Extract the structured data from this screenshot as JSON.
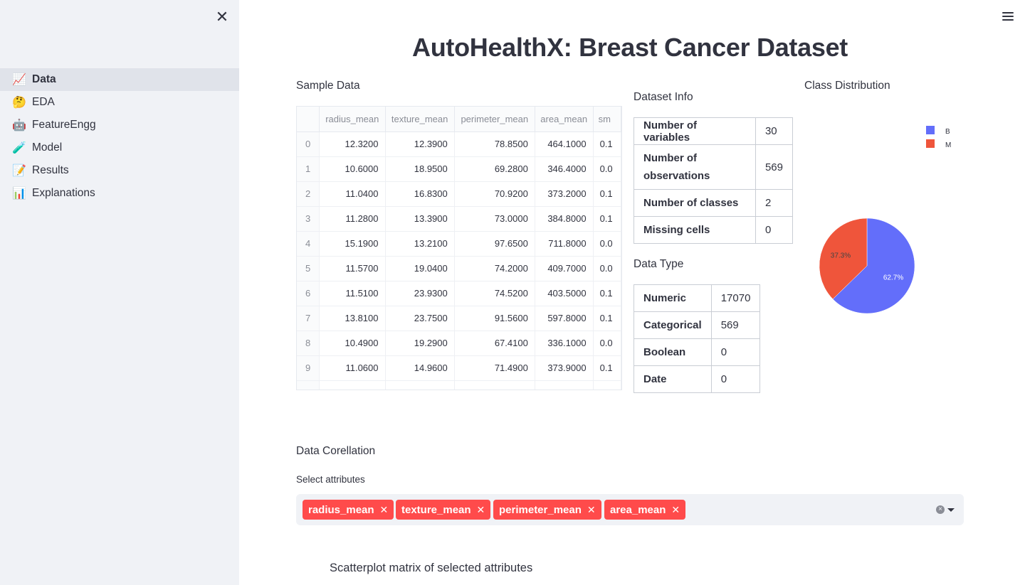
{
  "sidebar": {
    "close_icon": "close-icon",
    "items": [
      {
        "icon": "📈",
        "icon_name": "chart-increasing-icon",
        "label": "Data",
        "active": true
      },
      {
        "icon": "🤔",
        "icon_name": "thinking-face-icon",
        "label": "EDA",
        "active": false
      },
      {
        "icon": "🤖",
        "icon_name": "robot-icon",
        "label": "FeatureEngg",
        "active": false
      },
      {
        "icon": "🧪",
        "icon_name": "test-tube-icon",
        "label": "Model",
        "active": false
      },
      {
        "icon": "📝",
        "icon_name": "memo-icon",
        "label": "Results",
        "active": false
      },
      {
        "icon": "📊",
        "icon_name": "bar-chart-icon",
        "label": "Explanations",
        "active": false
      }
    ]
  },
  "header": {
    "title": "AutoHealthX: Breast Cancer Dataset",
    "menu_icon": "hamburger-menu-icon"
  },
  "sample_data": {
    "label": "Sample Data",
    "columns": [
      "",
      "radius_mean",
      "texture_mean",
      "perimeter_mean",
      "area_mean",
      "sm"
    ],
    "rows": [
      [
        "0",
        "12.3200",
        "12.3900",
        "78.8500",
        "464.1000",
        "0.1"
      ],
      [
        "1",
        "10.6000",
        "18.9500",
        "69.2800",
        "346.4000",
        "0.0"
      ],
      [
        "2",
        "11.0400",
        "16.8300",
        "70.9200",
        "373.2000",
        "0.1"
      ],
      [
        "3",
        "11.2800",
        "13.3900",
        "73.0000",
        "384.8000",
        "0.1"
      ],
      [
        "4",
        "15.1900",
        "13.2100",
        "97.6500",
        "711.8000",
        "0.0"
      ],
      [
        "5",
        "11.5700",
        "19.0400",
        "74.2000",
        "409.7000",
        "0.0"
      ],
      [
        "6",
        "11.5100",
        "23.9300",
        "74.5200",
        "403.5000",
        "0.1"
      ],
      [
        "7",
        "13.8100",
        "23.7500",
        "91.5600",
        "597.8000",
        "0.1"
      ],
      [
        "8",
        "10.4900",
        "19.2900",
        "67.4100",
        "336.1000",
        "0.0"
      ],
      [
        "9",
        "11.0600",
        "14.9600",
        "71.4900",
        "373.9000",
        "0.1"
      ]
    ]
  },
  "dataset_info": {
    "label": "Dataset Info",
    "rows": [
      {
        "key": "Number of variables",
        "value": "30"
      },
      {
        "key": "Number of observations",
        "value": "569"
      },
      {
        "key": "Number of classes",
        "value": "2"
      },
      {
        "key": "Missing cells",
        "value": "0"
      }
    ]
  },
  "data_type": {
    "label": "Data Type",
    "rows": [
      {
        "key": "Numeric",
        "value": "17070"
      },
      {
        "key": "Categorical",
        "value": "569"
      },
      {
        "key": "Boolean",
        "value": "0"
      },
      {
        "key": "Date",
        "value": "0"
      }
    ]
  },
  "class_distribution": {
    "label": "Class Distribution",
    "legend": [
      {
        "name": "B",
        "color": "#636efa"
      },
      {
        "name": "M",
        "color": "#ef553b"
      }
    ]
  },
  "chart_data": {
    "type": "pie",
    "title": "",
    "labels": [
      "B",
      "M"
    ],
    "values": [
      62.7,
      37.3
    ],
    "value_labels": [
      "62.7%",
      "37.3%"
    ],
    "colors": [
      "#636efa",
      "#ef553b"
    ],
    "legend_position": "top-right"
  },
  "correlation": {
    "label": "Data Corellation",
    "select_label": "Select attributes",
    "selected": [
      "radius_mean",
      "texture_mean",
      "perimeter_mean",
      "area_mean"
    ],
    "tag_remove_glyph": "✕",
    "clear_icon": "clear-circle-icon",
    "dropdown_icon": "chevron-down-icon",
    "scatter_title": "Scatterplot matrix of selected attributes"
  }
}
